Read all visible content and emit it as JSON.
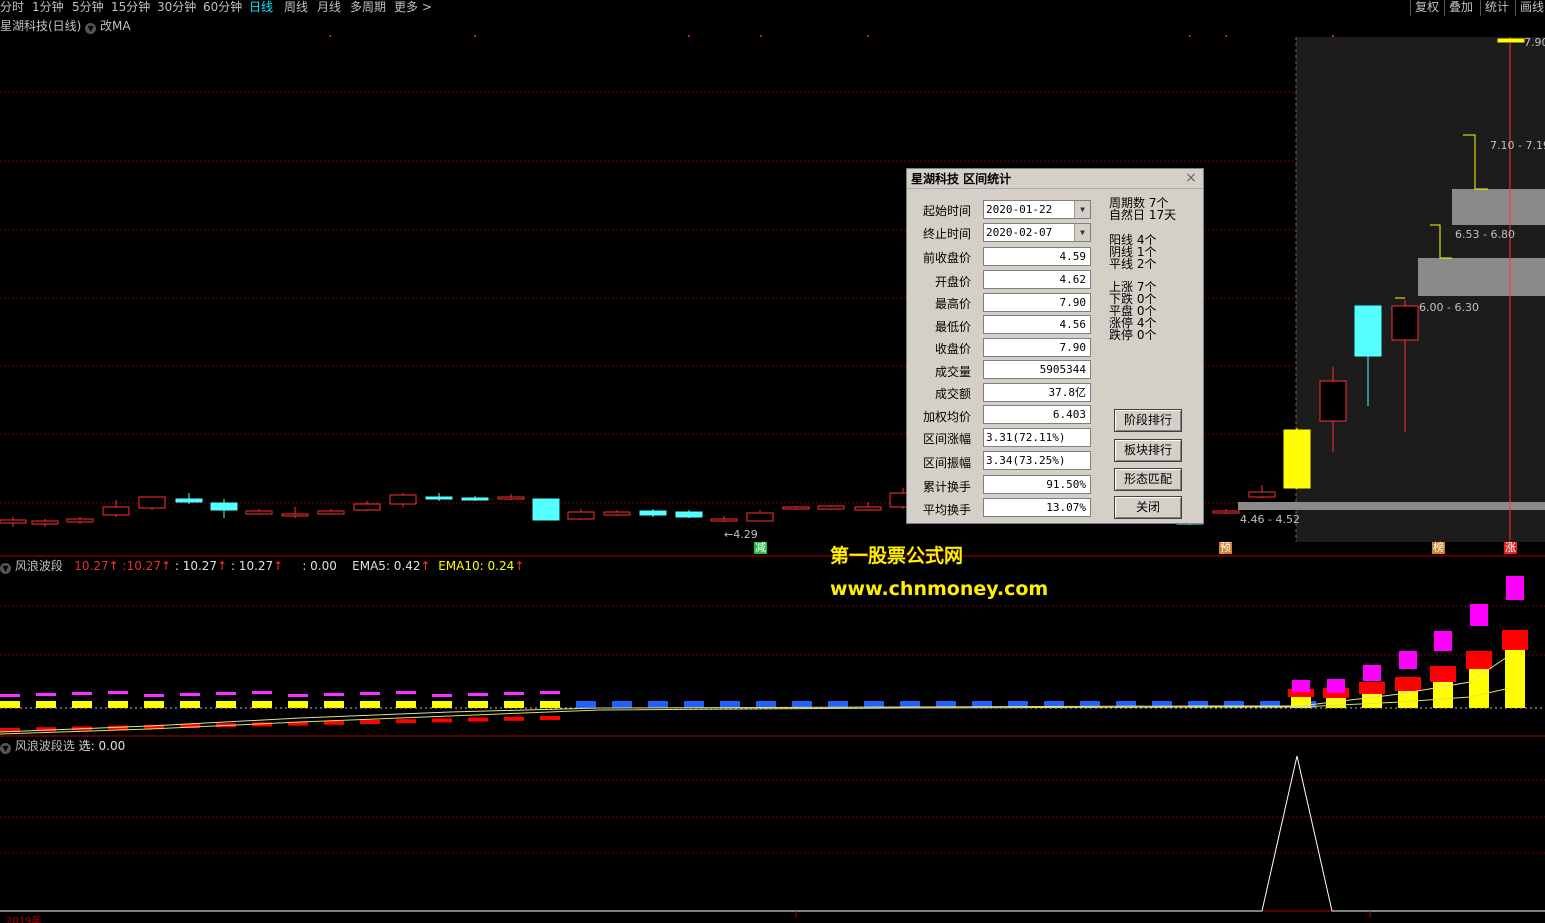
{
  "toolbar": {
    "periods": [
      "分时",
      "1分钟",
      "5分钟",
      "15分钟",
      "30分钟",
      "60分钟",
      "日线",
      "周线",
      "月线",
      "多周期",
      "更多 >"
    ],
    "right": [
      "复权",
      "叠加",
      "统计",
      "画线"
    ]
  },
  "chart_title": {
    "name": "星湖科技(日线)",
    "ma": "改MA"
  },
  "price_labels": {
    "top": "7.90",
    "low": "4.29",
    "z1": "7.10 - 7.19",
    "z2": "6.53 - 6.80",
    "z3": "6.00 - 6.30",
    "z4": "4.46 - 4.52"
  },
  "markers": {
    "m1": "减",
    "m2": "预",
    "m3": "榜",
    "m4": "涨"
  },
  "ind1": {
    "name": "风浪波段",
    "v1": "10.27",
    "v2": "10.27",
    "v3": ": 10.27",
    "v4": ": 10.27",
    "v5": ": 0.00",
    "ema5": "EMA5: 0.42",
    "ema10": "EMA10: 0.24"
  },
  "ind2": {
    "name": "风浪波段选",
    "sel": "选: 0.00"
  },
  "watermark": {
    "line1": "第一股票公式网",
    "line2": "www.chnmoney.com"
  },
  "dialog": {
    "title": "星湖科技 区间统计",
    "fields": {
      "start_label": "起始时间",
      "start": "2020-01-22",
      "end_label": "终止时间",
      "end": "2020-02-07",
      "prev_close_label": "前收盘价",
      "prev_close": "4.59",
      "open_label": "开盘价",
      "open": "4.62",
      "high_label": "最高价",
      "high": "7.90",
      "low_label": "最低价",
      "low": "4.56",
      "close_label": "收盘价",
      "close": "7.90",
      "volume_label": "成交量",
      "volume": "5905344",
      "amount_label": "成交额",
      "amount": "37.8亿",
      "vwap_label": "加权均价",
      "vwap": "6.403",
      "chg_label": "区间涨幅",
      "chg": "3.31(72.11%)",
      "amp_label": "区间振幅",
      "amp": "3.34(73.25%)",
      "turn_label": "累计换手",
      "turn": "91.50%",
      "avg_turn_label": "平均换手",
      "avg_turn": "13.07%"
    },
    "stats": {
      "periods": "周期数  7个",
      "days": "自然日  17天",
      "yang": "阳线  4个",
      "yin": "阴线  1个",
      "flat": "平线  2个",
      "up": "上涨  7个",
      "down": "下跌  0个",
      "even": "平盘  0个",
      "limit_up": "涨停  4个",
      "limit_down": "跌停  0个"
    },
    "buttons": {
      "rank": "阶段排行",
      "sector": "板块排行",
      "pattern": "形态匹配",
      "close": "关闭"
    }
  },
  "bottom_axis": {
    "year": "2019年"
  }
}
